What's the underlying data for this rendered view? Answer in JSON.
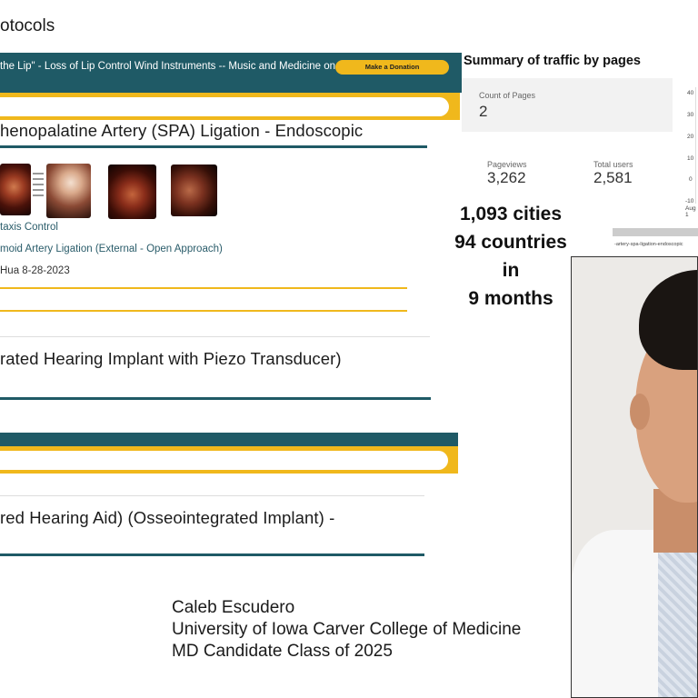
{
  "heading": "otocols",
  "site": {
    "banner_text": "the Lip\" - Loss of Lip Control Wind Instruments -- Music and Medicine on",
    "donate_label": "Make a Donation"
  },
  "articles": [
    {
      "title": "henopalatine Artery (SPA) Ligation - Endoscopic"
    },
    {
      "title": "rated Hearing Implant with Piezo Transducer)"
    },
    {
      "title": "red Hearing Aid) (Osseointegrated Implant) -"
    }
  ],
  "links": {
    "epistaxis": "taxis Control",
    "ethmoid": "moid Artery Ligation (External - Open Approach)",
    "author": "Hua 8-28-2023"
  },
  "analytics": {
    "title": "Summary of traffic by pages",
    "count_label": "Count of Pages",
    "count_value": "2",
    "pageviews_label": "Pageviews",
    "pageviews_value": "3,262",
    "users_label": "Total users",
    "users_value": "2,581",
    "y_ticks": [
      "40",
      "30",
      "20",
      "10",
      "0",
      "-10"
    ],
    "x_tick": "Aug 1",
    "url": "-artery-spa-ligation-endoscopic"
  },
  "reach": {
    "cities": "1,093 cities",
    "countries": "94 countries",
    "in": "in",
    "months": "9 months"
  },
  "caption": {
    "name": "Caleb Escudero",
    "school": "University of Iowa Carver College of Medicine",
    "program": "MD Candidate Class of 2025"
  },
  "colors": {
    "teal": "#1f5a66",
    "gold": "#f0b81c"
  }
}
